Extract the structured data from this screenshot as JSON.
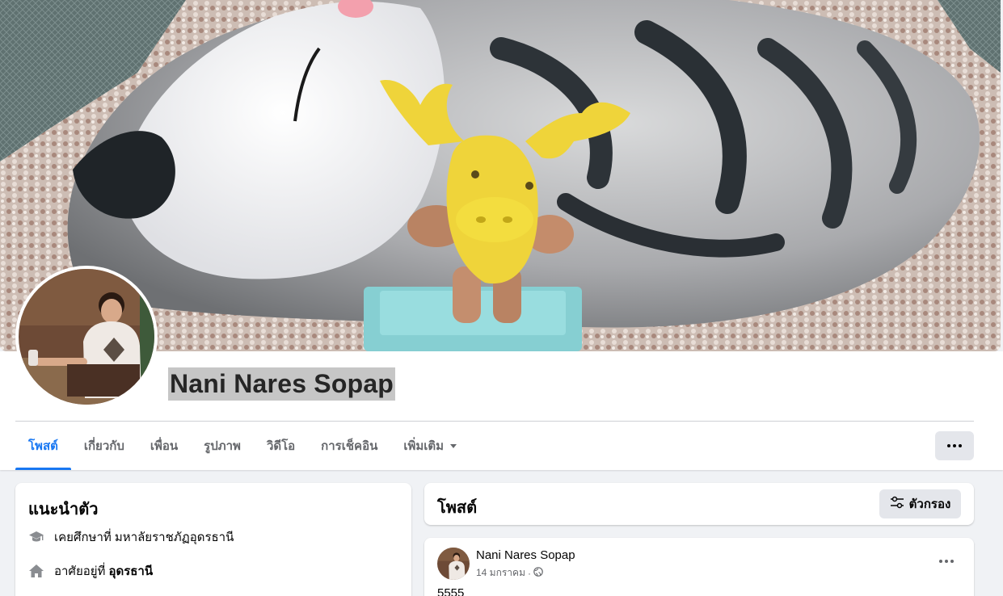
{
  "profile": {
    "name": "Nani Nares Sopap"
  },
  "tabs": [
    {
      "label": "โพสต์",
      "active": true
    },
    {
      "label": "เกี่ยวกับ"
    },
    {
      "label": "เพื่อน"
    },
    {
      "label": "รูปภาพ"
    },
    {
      "label": "วิดีโอ"
    },
    {
      "label": "การเช็คอิน"
    },
    {
      "label": "เพิ่มเติม"
    }
  ],
  "intro": {
    "title": "แนะนำตัว",
    "education": "เคยศึกษาที่ มหาลัยราชภัฏอุดรธานี",
    "lives_prefix": "อาศัยอยู่ที่",
    "lives_place": "อุดรธานี"
  },
  "posts_section": {
    "title": "โพสต์",
    "filter_label": "ตัวกรอง"
  },
  "post": {
    "author": "Nani Nares Sopap",
    "date": "14 มกราคม",
    "separator": "·",
    "text": "5555"
  },
  "icons": {
    "education": "graduation-cap-icon",
    "home": "home-icon",
    "filter": "sliders-icon",
    "privacy": "globe-icon",
    "more": "ellipsis-icon",
    "dropdown": "caret-down-icon"
  },
  "colors": {
    "accent": "#1877f2",
    "page_bg": "#f0f2f5",
    "secondary_text": "#65676b",
    "button_bg": "#e4e6eb",
    "name_highlight": "#c6c6c6"
  }
}
